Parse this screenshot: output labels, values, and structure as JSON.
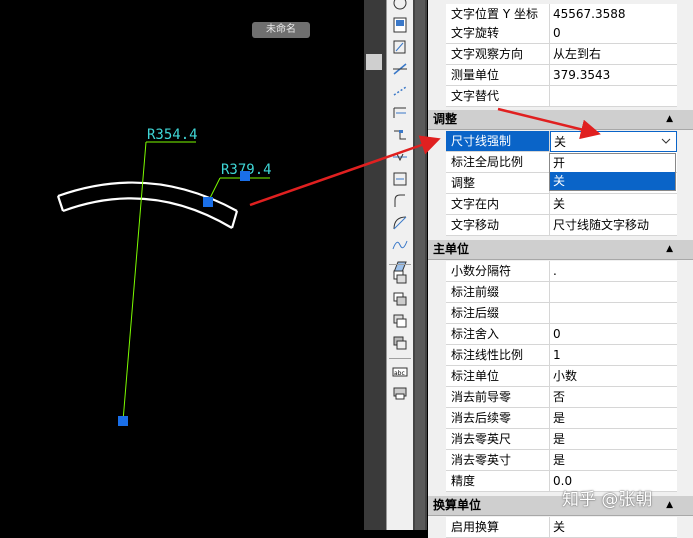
{
  "canvas": {
    "unnamed_label": "未命名",
    "dim_label_1": "R354.4",
    "dim_label_2": "R379.4",
    "line_color": "#7CFC00",
    "text_color": "#3fd6d6",
    "grip_color": "#1a6fe8"
  },
  "toolbar": {
    "icons": [
      "circle-icon",
      "new-file-icon",
      "dim-linear-icon",
      "dim-aligned-icon",
      "dim-aligned-2-icon",
      "dim-baseline-icon",
      "dim-continue-icon",
      "dim-break-icon",
      "dim-jog-icon",
      "dim-radius-icon",
      "dim-arc-icon",
      "dim-spline-icon",
      "dim-tolerance-icon",
      "layer-1-icon",
      "layer-2-icon",
      "layer-3-icon",
      "layer-4-icon",
      "abc-text-icon",
      "print-icon"
    ]
  },
  "props": {
    "top_rows": [
      {
        "key": "文字位置 Y 坐标",
        "value": "45567.3588"
      },
      {
        "key": "文字旋转",
        "value": "0"
      },
      {
        "key": "文字观察方向",
        "value": "从左到右"
      },
      {
        "key": "测量单位",
        "value": "379.3543"
      },
      {
        "key": "文字替代",
        "value": ""
      }
    ],
    "section_adjust": "调整",
    "adjust_rows": [
      {
        "key": "尺寸线强制",
        "value": "关"
      },
      {
        "key": "标注全局比例",
        "value": ""
      },
      {
        "key": "调整",
        "value": ""
      },
      {
        "key": "文字在内",
        "value": "关"
      },
      {
        "key": "文字移动",
        "value": "尺寸线随文字移动"
      }
    ],
    "dropdown_options": [
      "开",
      "关"
    ],
    "section_primary": "主单位",
    "primary_rows": [
      {
        "key": "小数分隔符",
        "value": "."
      },
      {
        "key": "标注前缀",
        "value": ""
      },
      {
        "key": "标注后缀",
        "value": ""
      },
      {
        "key": "标注舍入",
        "value": "0"
      },
      {
        "key": "标注线性比例",
        "value": "1"
      },
      {
        "key": "标注单位",
        "value": "小数"
      },
      {
        "key": "消去前导零",
        "value": "否"
      },
      {
        "key": "消去后续零",
        "value": "是"
      },
      {
        "key": "消去零英尺",
        "value": "是"
      },
      {
        "key": "消去零英寸",
        "value": "是"
      },
      {
        "key": "精度",
        "value": "0.0"
      }
    ],
    "section_alt": "换算单位",
    "alt_rows": [
      {
        "key": "启用换算",
        "value": "关"
      }
    ]
  },
  "watermark": "知乎 @张朝",
  "accent": "#0a64c8",
  "arrow_color": "#e02020"
}
